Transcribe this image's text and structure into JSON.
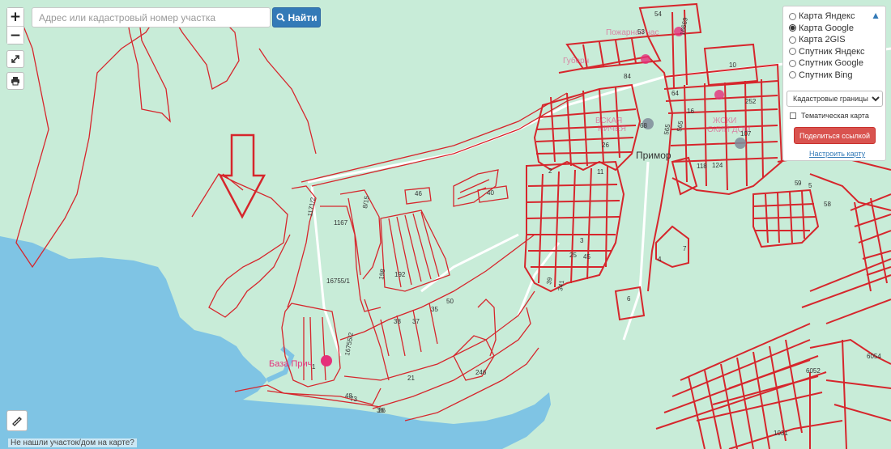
{
  "map": {
    "place_name": "Примор",
    "poi_label": "База Прич",
    "faded_labels": [
      "Пожарная час",
      "Губерн",
      "ВСКАЯ",
      "НИЧЕЯ",
      "ЖСКИ",
      "ОКИЙ ДОМ"
    ],
    "parcel_labels": [
      {
        "text": "54"
      },
      {
        "text": "53"
      },
      {
        "text": "16669"
      },
      {
        "text": "10"
      },
      {
        "text": "84"
      },
      {
        "text": "64"
      },
      {
        "text": "16"
      },
      {
        "text": "252"
      },
      {
        "text": "68"
      },
      {
        "text": "565"
      },
      {
        "text": "565"
      },
      {
        "text": "26"
      },
      {
        "text": "11"
      },
      {
        "text": "2"
      },
      {
        "text": "118"
      },
      {
        "text": "124"
      },
      {
        "text": "107"
      },
      {
        "text": "9"
      },
      {
        "text": "5"
      },
      {
        "text": "58"
      },
      {
        "text": "46"
      },
      {
        "text": "40"
      },
      {
        "text": "1171/2"
      },
      {
        "text": "1167"
      },
      {
        "text": "16755/1"
      },
      {
        "text": "8/15"
      },
      {
        "text": "198"
      },
      {
        "text": "192"
      },
      {
        "text": "3"
      },
      {
        "text": "45"
      },
      {
        "text": "25"
      },
      {
        "text": "39"
      },
      {
        "text": "341"
      },
      {
        "text": "6"
      },
      {
        "text": "7"
      },
      {
        "text": "4"
      },
      {
        "text": "50"
      },
      {
        "text": "35"
      },
      {
        "text": "36"
      },
      {
        "text": "37"
      },
      {
        "text": "38"
      },
      {
        "text": "16755/2"
      },
      {
        "text": "1"
      },
      {
        "text": "246"
      },
      {
        "text": "21"
      },
      {
        "text": "48"
      },
      {
        "text": "73"
      },
      {
        "text": "36"
      },
      {
        "text": "6054"
      },
      {
        "text": "6052"
      },
      {
        "text": "1031"
      },
      {
        "text": "5"
      }
    ]
  },
  "zoom": {
    "in_label": "+",
    "out_label": "−"
  },
  "search": {
    "placeholder": "Адрес или кадастровый номер участка",
    "button_label": "Найти"
  },
  "layers_panel": {
    "options": [
      {
        "label": "Карта Яндекс",
        "selected": false
      },
      {
        "label": "Карта Google",
        "selected": true
      },
      {
        "label": "Карта 2GIS",
        "selected": false
      },
      {
        "label": "Спутник Яндекс",
        "selected": false
      },
      {
        "label": "Спутник Google",
        "selected": false
      },
      {
        "label": "Спутник Bing",
        "selected": false
      }
    ],
    "overlay_select_value": "Кадастровые границы",
    "thematic_label": "Тематическая карта",
    "thematic_checked": false,
    "share_label": "Поделиться ссылкой",
    "configure_label": "Настроить карту"
  },
  "footer": {
    "not_found_text": "Не нашли участок/дом на карте?"
  },
  "colors": {
    "land": "#c8ecd8",
    "water": "#7fc4e4",
    "parcel_line": "#d6262c",
    "road": "#ffffff",
    "accent": "#337ab7",
    "share": "#d9534f"
  }
}
